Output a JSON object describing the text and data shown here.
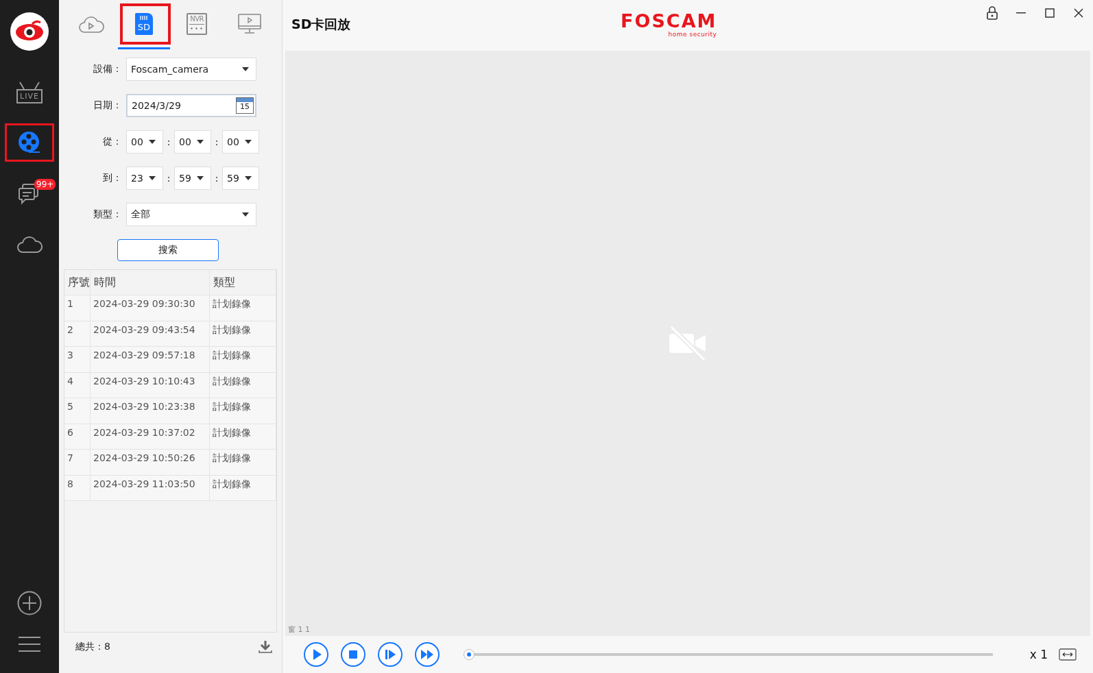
{
  "nav": {
    "items": [
      {
        "kind": "live",
        "label": "LIVE",
        "selected": false,
        "highlighted": false
      },
      {
        "kind": "playback",
        "selected": true,
        "highlighted": true
      },
      {
        "kind": "messages",
        "badge": "99+",
        "selected": false,
        "highlighted": false
      },
      {
        "kind": "cloud",
        "selected": false,
        "highlighted": false
      }
    ],
    "bottom": [
      {
        "kind": "add"
      },
      {
        "kind": "menu"
      }
    ]
  },
  "source_tabs": [
    {
      "kind": "cloud",
      "selected": false,
      "highlighted": false
    },
    {
      "kind": "sd",
      "label": "SD",
      "selected": true,
      "highlighted": true
    },
    {
      "kind": "nvr",
      "label": "NVR",
      "selected": false,
      "highlighted": false
    },
    {
      "kind": "monitor",
      "selected": false,
      "highlighted": false
    }
  ],
  "form": {
    "device": {
      "label": "設備：",
      "value": "Foscam_camera"
    },
    "date": {
      "label": "日期：",
      "value": "2024/3/29",
      "calendar_day": "15"
    },
    "from": {
      "label": "從：",
      "parts": [
        "00",
        "00",
        "00"
      ],
      "separators": [
        ":",
        ":"
      ]
    },
    "to": {
      "label": "到：",
      "parts": [
        "23",
        "59",
        "59"
      ],
      "separators": [
        ":",
        ":"
      ]
    },
    "type": {
      "label": "類型：",
      "value": "全部"
    },
    "search_button": "搜索"
  },
  "table": {
    "columns": [
      "序號",
      "時間",
      "類型"
    ],
    "rows": [
      [
        "1",
        "2024-03-29 09:30:30",
        "計划錄像"
      ],
      [
        "2",
        "2024-03-29 09:43:54",
        "計划錄像"
      ],
      [
        "3",
        "2024-03-29 09:57:18",
        "計划錄像"
      ],
      [
        "4",
        "2024-03-29 10:10:43",
        "計划錄像"
      ],
      [
        "5",
        "2024-03-29 10:23:38",
        "計划錄像"
      ],
      [
        "6",
        "2024-03-29 10:37:02",
        "計划錄像"
      ],
      [
        "7",
        "2024-03-29 10:50:26",
        "計划錄像"
      ],
      [
        "8",
        "2024-03-29 11:03:50",
        "計划錄像"
      ]
    ]
  },
  "total": "總共：8",
  "header": {
    "title": "SD卡回放",
    "logo": {
      "name": "FOSCAM",
      "tagline": "home security"
    }
  },
  "video": {
    "channel_label": "窗 1 1"
  },
  "player": {
    "level": 0,
    "speed": "x 1"
  }
}
